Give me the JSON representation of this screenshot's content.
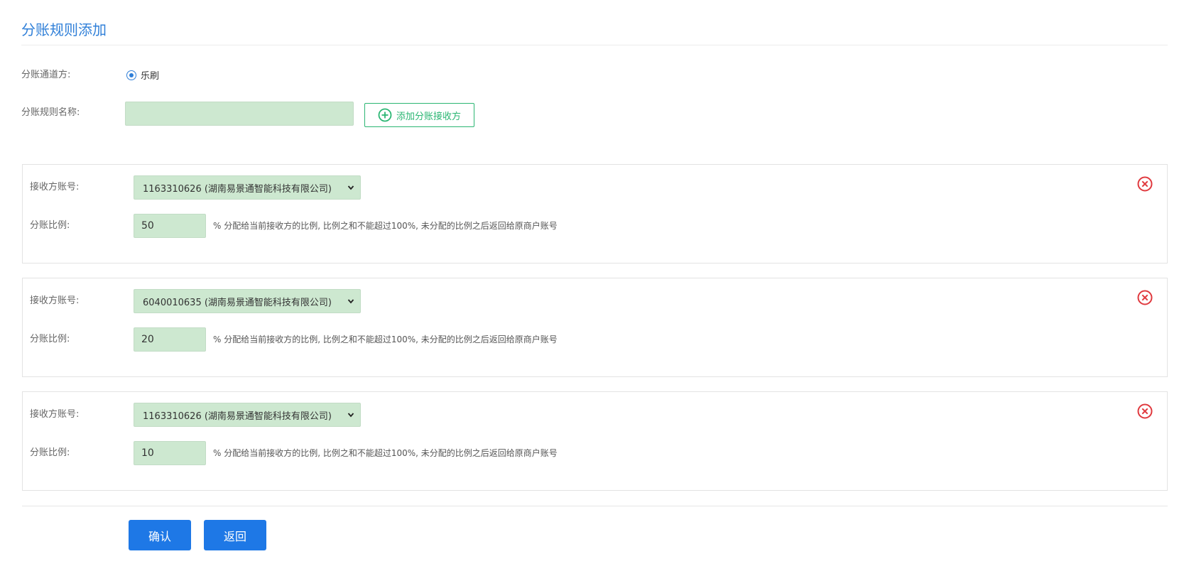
{
  "page": {
    "title": "分账规则添加"
  },
  "form": {
    "channel_label": "分账通道方:",
    "channel_option": "乐刷",
    "rule_name_label": "分账规则名称:",
    "rule_name_value": "",
    "add_receiver_label": "添加分账接收方"
  },
  "receivers": [
    {
      "account_label": "接收方账号:",
      "account_value": "1163310626 (湖南易景通智能科技有限公司)",
      "ratio_label": "分账比例:",
      "ratio_value": "50",
      "ratio_hint": "% 分配给当前接收方的比例, 比例之和不能超过100%, 未分配的比例之后返回给原商户账号"
    },
    {
      "account_label": "接收方账号:",
      "account_value": "6040010635 (湖南易景通智能科技有限公司)",
      "ratio_label": "分账比例:",
      "ratio_value": "20",
      "ratio_hint": "% 分配给当前接收方的比例, 比例之和不能超过100%, 未分配的比例之后返回给原商户账号"
    },
    {
      "account_label": "接收方账号:",
      "account_value": "1163310626 (湖南易景通智能科技有限公司)",
      "ratio_label": "分账比例:",
      "ratio_value": "10",
      "ratio_hint": "% 分配给当前接收方的比例, 比例之和不能超过100%, 未分配的比例之后返回给原商户账号"
    }
  ],
  "actions": {
    "confirm_label": "确认",
    "back_label": "返回"
  },
  "colors": {
    "accent": "#2f7fd8",
    "primary_button": "#1e78e6",
    "add_button": "#2bb673",
    "remove_icon": "#e0393e",
    "input_bg": "#cde8d0"
  }
}
